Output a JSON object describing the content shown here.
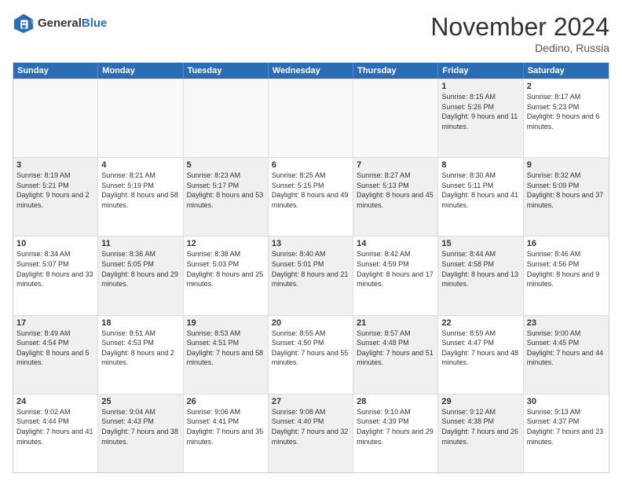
{
  "header": {
    "logo_general": "General",
    "logo_blue": "Blue",
    "month_title": "November 2024",
    "location": "Dedino, Russia"
  },
  "calendar": {
    "days_of_week": [
      "Sunday",
      "Monday",
      "Tuesday",
      "Wednesday",
      "Thursday",
      "Friday",
      "Saturday"
    ],
    "rows": [
      [
        {
          "day": "",
          "info": "",
          "empty": true
        },
        {
          "day": "",
          "info": "",
          "empty": true
        },
        {
          "day": "",
          "info": "",
          "empty": true
        },
        {
          "day": "",
          "info": "",
          "empty": true
        },
        {
          "day": "",
          "info": "",
          "empty": true
        },
        {
          "day": "1",
          "info": "Sunrise: 8:15 AM\nSunset: 5:26 PM\nDaylight: 9 hours and 11 minutes.",
          "shaded": true
        },
        {
          "day": "2",
          "info": "Sunrise: 8:17 AM\nSunset: 5:23 PM\nDaylight: 9 hours and 6 minutes.",
          "shaded": false
        }
      ],
      [
        {
          "day": "3",
          "info": "Sunrise: 8:19 AM\nSunset: 5:21 PM\nDaylight: 9 hours and 2 minutes.",
          "shaded": true
        },
        {
          "day": "4",
          "info": "Sunrise: 8:21 AM\nSunset: 5:19 PM\nDaylight: 8 hours and 58 minutes.",
          "shaded": false
        },
        {
          "day": "5",
          "info": "Sunrise: 8:23 AM\nSunset: 5:17 PM\nDaylight: 8 hours and 53 minutes.",
          "shaded": true
        },
        {
          "day": "6",
          "info": "Sunrise: 8:25 AM\nSunset: 5:15 PM\nDaylight: 8 hours and 49 minutes.",
          "shaded": false
        },
        {
          "day": "7",
          "info": "Sunrise: 8:27 AM\nSunset: 5:13 PM\nDaylight: 8 hours and 45 minutes.",
          "shaded": true
        },
        {
          "day": "8",
          "info": "Sunrise: 8:30 AM\nSunset: 5:11 PM\nDaylight: 8 hours and 41 minutes.",
          "shaded": false
        },
        {
          "day": "9",
          "info": "Sunrise: 8:32 AM\nSunset: 5:09 PM\nDaylight: 8 hours and 37 minutes.",
          "shaded": true
        }
      ],
      [
        {
          "day": "10",
          "info": "Sunrise: 8:34 AM\nSunset: 5:07 PM\nDaylight: 8 hours and 33 minutes.",
          "shaded": false
        },
        {
          "day": "11",
          "info": "Sunrise: 8:36 AM\nSunset: 5:05 PM\nDaylight: 8 hours and 29 minutes.",
          "shaded": true
        },
        {
          "day": "12",
          "info": "Sunrise: 8:38 AM\nSunset: 5:03 PM\nDaylight: 8 hours and 25 minutes.",
          "shaded": false
        },
        {
          "day": "13",
          "info": "Sunrise: 8:40 AM\nSunset: 5:01 PM\nDaylight: 8 hours and 21 minutes.",
          "shaded": true
        },
        {
          "day": "14",
          "info": "Sunrise: 8:42 AM\nSunset: 4:59 PM\nDaylight: 8 hours and 17 minutes.",
          "shaded": false
        },
        {
          "day": "15",
          "info": "Sunrise: 8:44 AM\nSunset: 4:58 PM\nDaylight: 8 hours and 13 minutes.",
          "shaded": true
        },
        {
          "day": "16",
          "info": "Sunrise: 8:46 AM\nSunset: 4:56 PM\nDaylight: 8 hours and 9 minutes.",
          "shaded": false
        }
      ],
      [
        {
          "day": "17",
          "info": "Sunrise: 8:49 AM\nSunset: 4:54 PM\nDaylight: 8 hours and 5 minutes.",
          "shaded": true
        },
        {
          "day": "18",
          "info": "Sunrise: 8:51 AM\nSunset: 4:53 PM\nDaylight: 8 hours and 2 minutes.",
          "shaded": false
        },
        {
          "day": "19",
          "info": "Sunrise: 8:53 AM\nSunset: 4:51 PM\nDaylight: 7 hours and 58 minutes.",
          "shaded": true
        },
        {
          "day": "20",
          "info": "Sunrise: 8:55 AM\nSunset: 4:50 PM\nDaylight: 7 hours and 55 minutes.",
          "shaded": false
        },
        {
          "day": "21",
          "info": "Sunrise: 8:57 AM\nSunset: 4:48 PM\nDaylight: 7 hours and 51 minutes.",
          "shaded": true
        },
        {
          "day": "22",
          "info": "Sunrise: 8:59 AM\nSunset: 4:47 PM\nDaylight: 7 hours and 48 minutes.",
          "shaded": false
        },
        {
          "day": "23",
          "info": "Sunrise: 9:00 AM\nSunset: 4:45 PM\nDaylight: 7 hours and 44 minutes.",
          "shaded": true
        }
      ],
      [
        {
          "day": "24",
          "info": "Sunrise: 9:02 AM\nSunset: 4:44 PM\nDaylight: 7 hours and 41 minutes.",
          "shaded": false
        },
        {
          "day": "25",
          "info": "Sunrise: 9:04 AM\nSunset: 4:43 PM\nDaylight: 7 hours and 38 minutes.",
          "shaded": true
        },
        {
          "day": "26",
          "info": "Sunrise: 9:06 AM\nSunset: 4:41 PM\nDaylight: 7 hours and 35 minutes.",
          "shaded": false
        },
        {
          "day": "27",
          "info": "Sunrise: 9:08 AM\nSunset: 4:40 PM\nDaylight: 7 hours and 32 minutes.",
          "shaded": true
        },
        {
          "day": "28",
          "info": "Sunrise: 9:10 AM\nSunset: 4:39 PM\nDaylight: 7 hours and 29 minutes.",
          "shaded": false
        },
        {
          "day": "29",
          "info": "Sunrise: 9:12 AM\nSunset: 4:38 PM\nDaylight: 7 hours and 26 minutes.",
          "shaded": true
        },
        {
          "day": "30",
          "info": "Sunrise: 9:13 AM\nSunset: 4:37 PM\nDaylight: 7 hours and 23 minutes.",
          "shaded": false
        }
      ]
    ]
  }
}
